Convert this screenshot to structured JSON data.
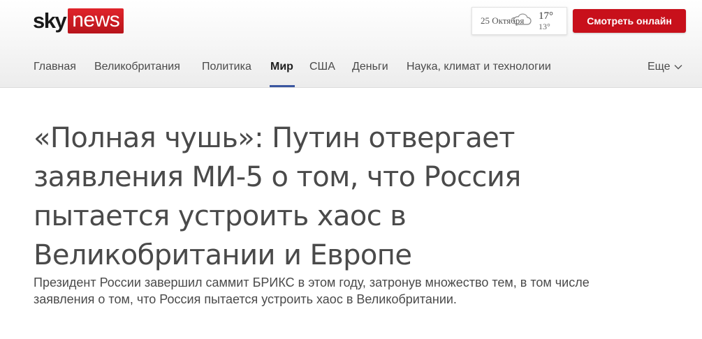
{
  "header": {
    "logo": {
      "sky": "sky",
      "news": "news"
    },
    "weather": {
      "date": "25 Октября",
      "high": "17°",
      "low": "13°",
      "icon": "cloud-icon"
    },
    "watch_button": "Смотреть онлайн"
  },
  "nav": {
    "items": [
      "Главная",
      "Великобритания",
      "Политика",
      "Мир",
      "США",
      "Деньги",
      "Наука, климат и технологии"
    ],
    "active": "Мир",
    "more": "Еще"
  },
  "article": {
    "headline": "«Полная чушь»: Путин отвергает заявления МИ-5 о том, что Россия пытается устроить хаос в Великобритании и Европе",
    "standfirst": "Президент России завершил саммит БРИКС в этом году, затронув множество тем, в том числе заявления о том, что Россия пытается устроить хаос в Великобритании."
  },
  "colors": {
    "brand_red": "#c8101b",
    "nav_active_underline": "#3a56a0"
  }
}
